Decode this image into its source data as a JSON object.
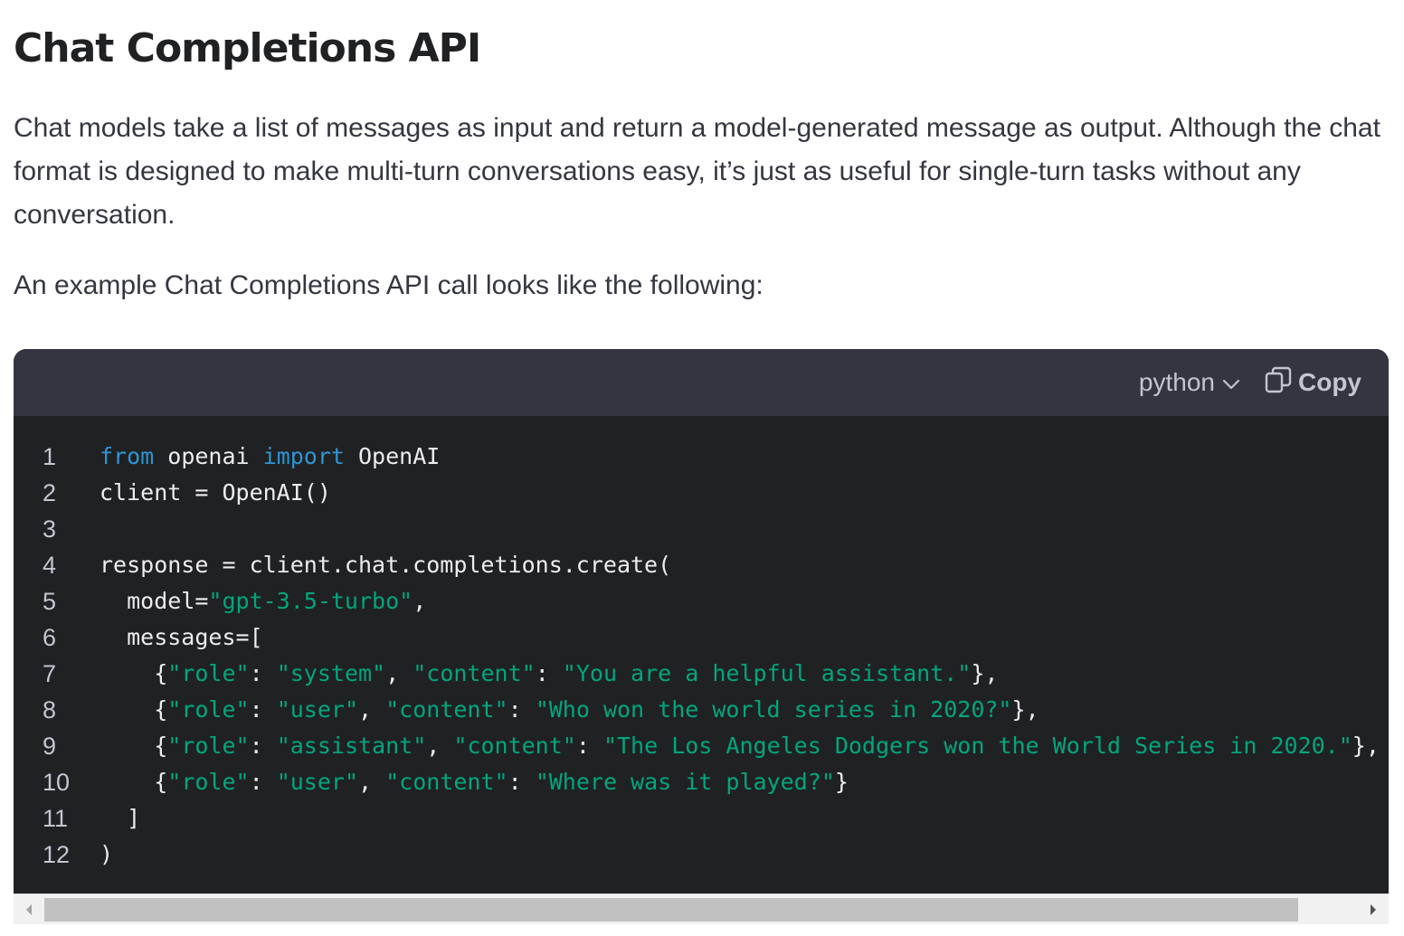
{
  "heading": "Chat Completions API",
  "intro_paragraph": "Chat models take a list of messages as input and return a model-generated message as output. Although the chat format is designed to make multi-turn conversations easy, it’s just as useful for single-turn tasks without any conversation.",
  "example_text": "An example Chat Completions API call looks like the following:",
  "code_block": {
    "language": "python",
    "copy_label": "Copy",
    "icons": {
      "language_dropdown": "chevron-down-icon",
      "copy": "copy-icon"
    },
    "syntax_colors": {
      "keyword": "#2e95d3",
      "string": "#00a67d",
      "text": "#ececf1"
    },
    "lines": [
      {
        "number": "1",
        "tokens": [
          {
            "t": "from",
            "k": "kw"
          },
          {
            "t": " openai ",
            "k": "txt"
          },
          {
            "t": "import",
            "k": "kw"
          },
          {
            "t": " OpenAI",
            "k": "txt"
          }
        ]
      },
      {
        "number": "2",
        "tokens": [
          {
            "t": "client = OpenAI()",
            "k": "txt"
          }
        ]
      },
      {
        "number": "3",
        "tokens": []
      },
      {
        "number": "4",
        "tokens": [
          {
            "t": "response = client.chat.completions.create(",
            "k": "txt"
          }
        ]
      },
      {
        "number": "5",
        "tokens": [
          {
            "t": "  model=",
            "k": "txt"
          },
          {
            "t": "\"gpt-3.5-turbo\"",
            "k": "str"
          },
          {
            "t": ",",
            "k": "txt"
          }
        ]
      },
      {
        "number": "6",
        "tokens": [
          {
            "t": "  messages=[",
            "k": "txt"
          }
        ]
      },
      {
        "number": "7",
        "tokens": [
          {
            "t": "    {",
            "k": "txt"
          },
          {
            "t": "\"role\"",
            "k": "str"
          },
          {
            "t": ": ",
            "k": "txt"
          },
          {
            "t": "\"system\"",
            "k": "str"
          },
          {
            "t": ", ",
            "k": "txt"
          },
          {
            "t": "\"content\"",
            "k": "str"
          },
          {
            "t": ": ",
            "k": "txt"
          },
          {
            "t": "\"You are a helpful assistant.\"",
            "k": "str"
          },
          {
            "t": "},",
            "k": "txt"
          }
        ]
      },
      {
        "number": "8",
        "tokens": [
          {
            "t": "    {",
            "k": "txt"
          },
          {
            "t": "\"role\"",
            "k": "str"
          },
          {
            "t": ": ",
            "k": "txt"
          },
          {
            "t": "\"user\"",
            "k": "str"
          },
          {
            "t": ", ",
            "k": "txt"
          },
          {
            "t": "\"content\"",
            "k": "str"
          },
          {
            "t": ": ",
            "k": "txt"
          },
          {
            "t": "\"Who won the world series in 2020?\"",
            "k": "str"
          },
          {
            "t": "},",
            "k": "txt"
          }
        ]
      },
      {
        "number": "9",
        "tokens": [
          {
            "t": "    {",
            "k": "txt"
          },
          {
            "t": "\"role\"",
            "k": "str"
          },
          {
            "t": ": ",
            "k": "txt"
          },
          {
            "t": "\"assistant\"",
            "k": "str"
          },
          {
            "t": ", ",
            "k": "txt"
          },
          {
            "t": "\"content\"",
            "k": "str"
          },
          {
            "t": ": ",
            "k": "txt"
          },
          {
            "t": "\"The Los Angeles Dodgers won the World Series in 2020.\"",
            "k": "str"
          },
          {
            "t": "},",
            "k": "txt"
          }
        ]
      },
      {
        "number": "10",
        "tokens": [
          {
            "t": "    {",
            "k": "txt"
          },
          {
            "t": "\"role\"",
            "k": "str"
          },
          {
            "t": ": ",
            "k": "txt"
          },
          {
            "t": "\"user\"",
            "k": "str"
          },
          {
            "t": ", ",
            "k": "txt"
          },
          {
            "t": "\"content\"",
            "k": "str"
          },
          {
            "t": ": ",
            "k": "txt"
          },
          {
            "t": "\"Where was it played?\"",
            "k": "str"
          },
          {
            "t": "}",
            "k": "txt"
          }
        ]
      },
      {
        "number": "11",
        "tokens": [
          {
            "t": "  ]",
            "k": "txt"
          }
        ]
      },
      {
        "number": "12",
        "tokens": [
          {
            "t": ")",
            "k": "txt"
          }
        ]
      }
    ]
  },
  "scrollbar": {
    "icons": {
      "left": "scroll-left-arrow-icon",
      "right": "scroll-right-arrow-icon"
    }
  }
}
